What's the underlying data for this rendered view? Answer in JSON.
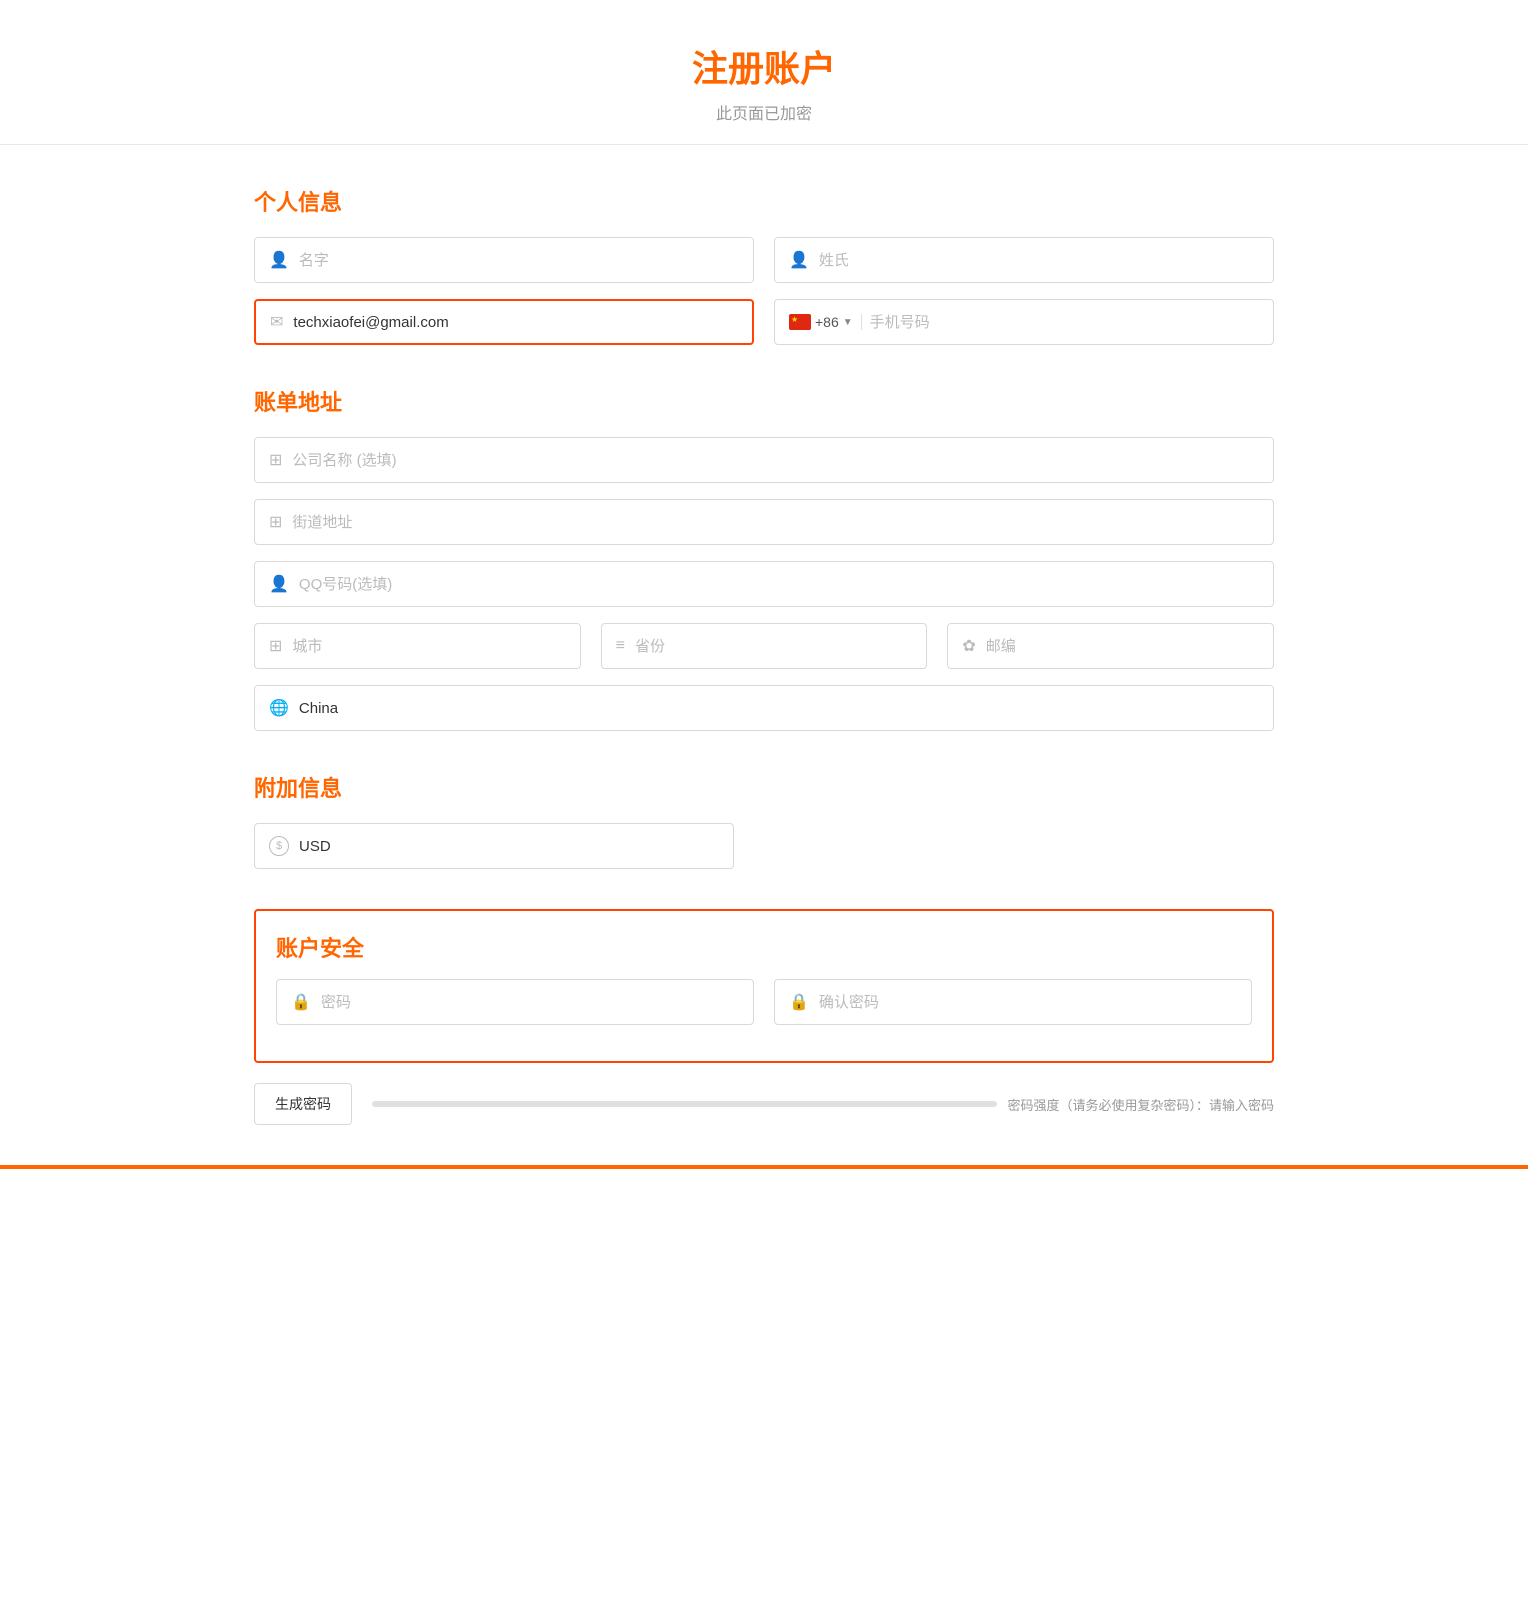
{
  "page": {
    "title": "注册账户",
    "subtitle": "此页面已加密"
  },
  "sections": {
    "personal_info": {
      "title": "个人信息",
      "fields": {
        "first_name": {
          "placeholder": "名字",
          "value": ""
        },
        "last_name": {
          "placeholder": "姓氏",
          "value": ""
        },
        "email": {
          "placeholder": "techxiaofei@gmail.com",
          "value": "techxiaofei@gmail.com"
        },
        "phone_prefix": "+86",
        "phone": {
          "placeholder": "手机号码",
          "value": ""
        }
      }
    },
    "billing_address": {
      "title": "账单地址",
      "fields": {
        "company": {
          "placeholder": "公司名称 (选填)",
          "value": ""
        },
        "street": {
          "placeholder": "街道地址",
          "value": ""
        },
        "qq": {
          "placeholder": "QQ号码(选填)",
          "value": ""
        },
        "city": {
          "placeholder": "城市",
          "value": ""
        },
        "province": {
          "placeholder": "省份",
          "value": ""
        },
        "postal": {
          "placeholder": "邮编",
          "value": ""
        },
        "country": {
          "value": "China"
        }
      }
    },
    "additional_info": {
      "title": "附加信息",
      "fields": {
        "currency": {
          "value": "USD"
        }
      }
    },
    "account_security": {
      "title": "账户安全",
      "fields": {
        "password": {
          "placeholder": "密码",
          "value": ""
        },
        "confirm_password": {
          "placeholder": "确认密码",
          "value": ""
        }
      },
      "generate_btn_label": "生成密码",
      "strength_label": "密码强度（请务必使用复杂密码）：请输入密码"
    }
  },
  "icons": {
    "person": "👤",
    "mail": "✉",
    "building": "⊞",
    "filter": "≡",
    "gear": "✿",
    "globe": "🌐",
    "lock": "🔒",
    "currency": "$"
  }
}
